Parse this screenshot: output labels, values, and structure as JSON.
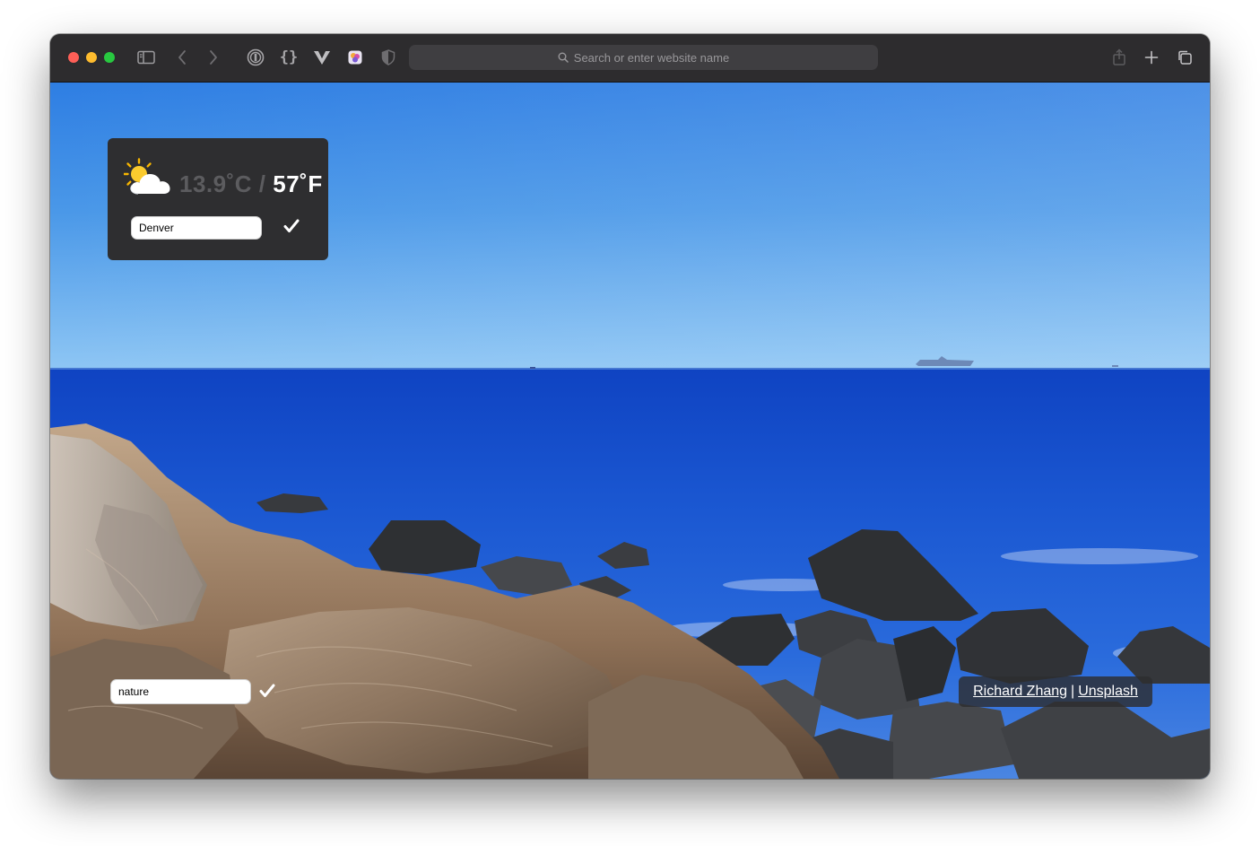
{
  "browser": {
    "address_placeholder": "Search or enter website name",
    "toolbar_icons": [
      "sidebar-icon",
      "back-icon",
      "forward-icon",
      "password-manager-icon",
      "json-viewer-icon",
      "vue-devtools-icon",
      "extension-icon",
      "privacy-shield-icon",
      "share-icon",
      "new-tab-icon",
      "tab-overview-icon"
    ]
  },
  "weather": {
    "icon": "partly-cloudy-icon",
    "celsius": "13.9˚C",
    "separator": "/",
    "fahrenheit": "57˚F",
    "city_value": "Denver",
    "confirm_icon": "checkmark-icon"
  },
  "search": {
    "keyword_value": "nature",
    "confirm_icon": "checkmark-icon"
  },
  "credit": {
    "photographer": "Richard Zhang",
    "separator": "|",
    "source": "Unsplash"
  },
  "colors": {
    "toolbar": "#2d2c2e",
    "address_bar": "#3f3e41",
    "widget_bg": "#2e2e30",
    "sky": "#3d8ce6",
    "sea": "#1a55c9"
  }
}
